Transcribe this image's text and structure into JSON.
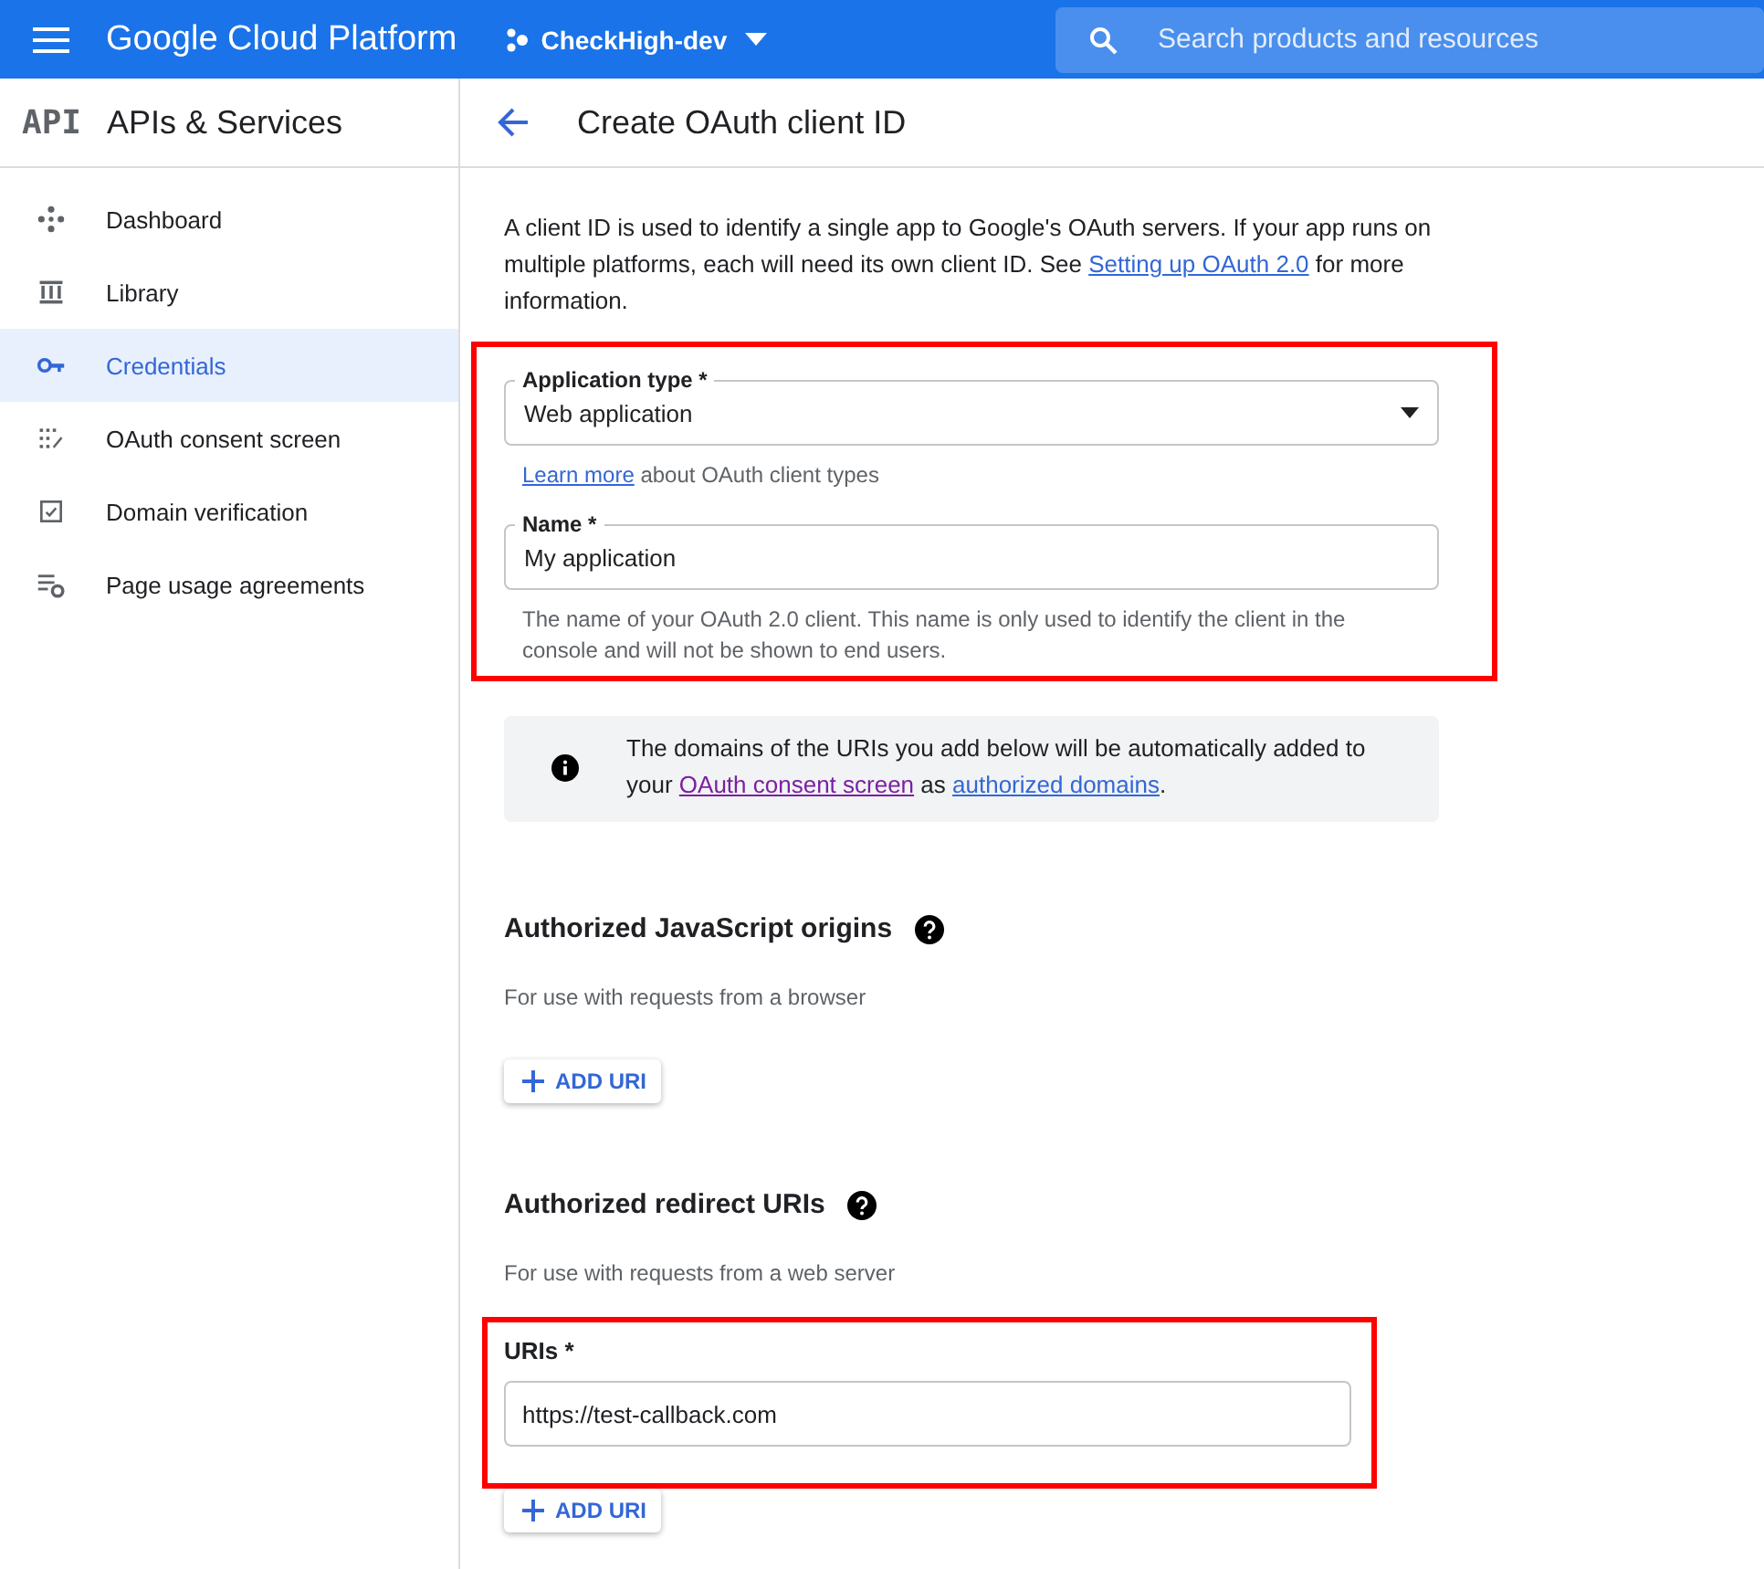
{
  "top_bar": {
    "product": "Google Cloud Platform",
    "project": "CheckHigh-dev",
    "search": {
      "placeholder": "Search products and resources"
    }
  },
  "sidebar": {
    "logo": "API",
    "title": "APIs & Services",
    "items": [
      {
        "label": "Dashboard",
        "selected": false
      },
      {
        "label": "Library",
        "selected": false
      },
      {
        "label": "Credentials",
        "selected": true
      },
      {
        "label": "OAuth consent screen",
        "selected": false
      },
      {
        "label": "Domain verification",
        "selected": false
      },
      {
        "label": "Page usage agreements",
        "selected": false
      }
    ]
  },
  "page": {
    "title": "Create OAuth client ID",
    "intro": {
      "before": "A client ID is used to identify a single app to Google's OAuth servers. If your app runs on multiple platforms, each will need its own client ID. See ",
      "link": "Setting up OAuth 2.0",
      "after": " for more information."
    },
    "client_group": {
      "highlighted": true,
      "fields": [
        {
          "kind": "dropdown",
          "label": "Application type *",
          "value": "Web application",
          "hint_link": "Learn more",
          "hint": " about OAuth client types"
        },
        {
          "kind": "text",
          "label": "Name *",
          "value": "My application",
          "hint": "The name of your OAuth 2.0 client. This name is only used to identify the client in the console and will not be shown to end users."
        }
      ]
    },
    "info": {
      "before": "The domains of the URIs you add below will be automatically added to your ",
      "link1": {
        "text": "OAuth consent screen",
        "visited": true
      },
      "middle": " as ",
      "link2": {
        "text": "authorized domains",
        "visited": false
      },
      "after": "."
    },
    "sections": [
      {
        "title": "Authorized JavaScript origins",
        "subtitle": "For use with requests from a browser",
        "button": "ADD URI"
      },
      {
        "title": "Authorized redirect URIs",
        "subtitle": "For use with requests from a web server",
        "uris": {
          "label": "URIs *",
          "value": "https://test-callback.com",
          "highlighted": true
        },
        "button": "ADD URI"
      }
    ]
  }
}
